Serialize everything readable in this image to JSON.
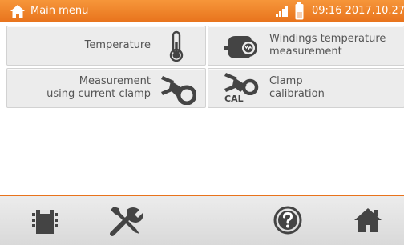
{
  "header": {
    "title": "Main menu",
    "time": "09:16 2017.10.27",
    "home_icon": "home-icon",
    "signal_icon": "signal-icon",
    "battery_icon": "battery-icon"
  },
  "menu": {
    "temperature": {
      "label": "Temperature",
      "icon": "thermometer-icon"
    },
    "windings": {
      "line1": "Windings temperature",
      "line2": "measurement",
      "icon": "motor-icon"
    },
    "clamp_measurement": {
      "line1": "Measurement",
      "line2": "using current clamp",
      "icon": "current-clamp-icon"
    },
    "clamp_calibration": {
      "line1": "Clamp",
      "line2": "calibration",
      "icon_text": "CAL",
      "icon": "clamp-calibration-icon"
    }
  },
  "toolbar": {
    "memory_icon": "memory-card-icon",
    "settings_icon": "tools-icon",
    "help_icon": "help-icon",
    "home_icon": "home-icon"
  },
  "colors": {
    "accent": "#e8731c",
    "tile_bg": "#ececec",
    "icon_dark": "#444444"
  }
}
